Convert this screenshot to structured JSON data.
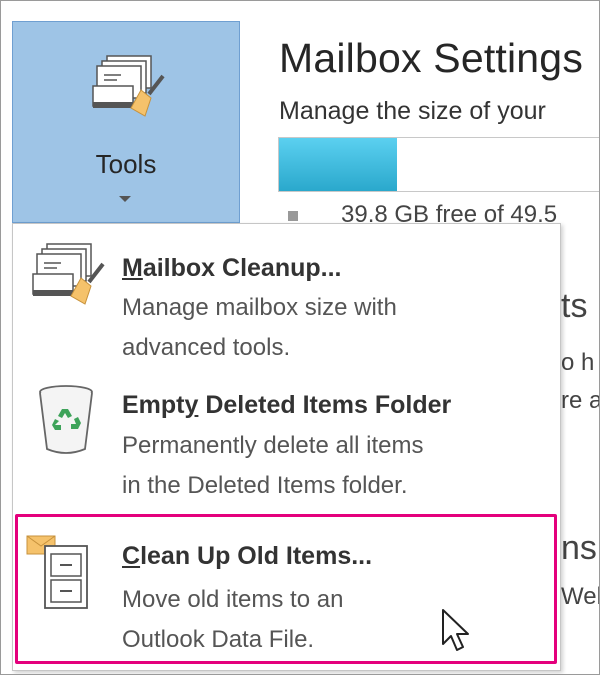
{
  "tools": {
    "label": "Tools",
    "icon": "mailbox-cleanup-icon"
  },
  "backstage": {
    "title": "Mailbox Settings",
    "subtitle": "Manage the size of your",
    "usage": {
      "fill_fraction": 0.36,
      "free_text": "39.8 GB free of 49.5"
    },
    "peek_texts": [
      "ts",
      "o h",
      "re a",
      "ns",
      "Wel"
    ]
  },
  "menu": {
    "items": [
      {
        "mnemonic": "M",
        "title_rest": "ailbox Cleanup...",
        "desc_line1": "Manage mailbox size with",
        "desc_line2": "advanced tools.",
        "icon": "mailbox-cleanup-icon"
      },
      {
        "title_pre": "Empt",
        "mnemonic": "y",
        "title_post": " Deleted Items Folder",
        "desc_line1": "Permanently delete all items",
        "desc_line2": "in the Deleted Items folder.",
        "icon": "recycle-bin-icon"
      },
      {
        "mnemonic": "C",
        "title_rest": "lean Up Old Items...",
        "desc_line1": "Move old items to an",
        "desc_line2": "Outlook Data File.",
        "icon": "archive-cabinet-icon"
      }
    ]
  },
  "colors": {
    "tools_selected": "#9ec4e6",
    "usage_fill": "#2aa8cc",
    "highlight": "#e4007c"
  }
}
